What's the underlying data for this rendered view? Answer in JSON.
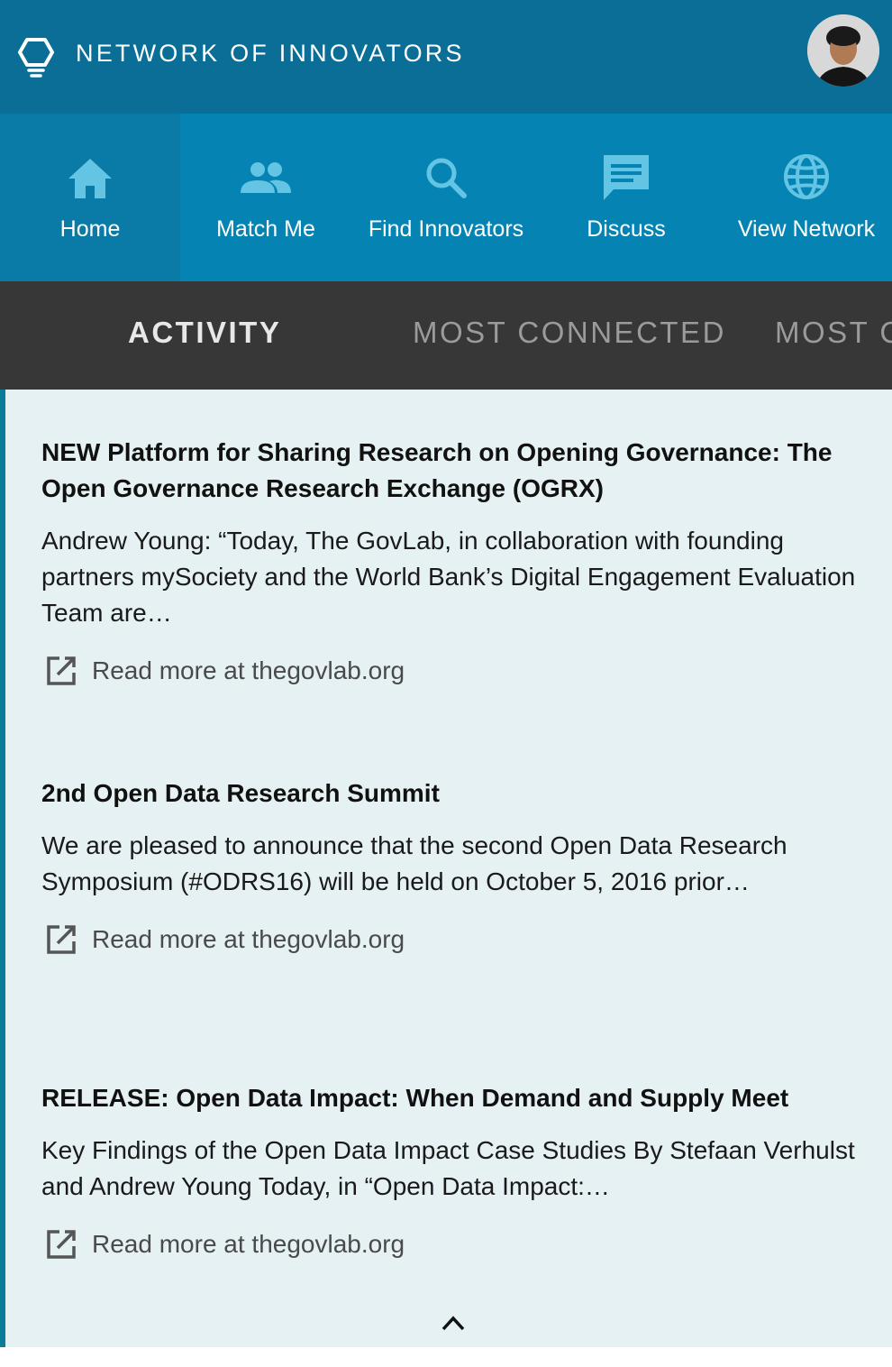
{
  "header": {
    "brand": "NETWORK OF INNOVATORS",
    "logo_icon": "lightbulb-icon",
    "avatar": "user-avatar"
  },
  "nav": {
    "items": [
      {
        "label": "Home",
        "icon": "home-icon",
        "active": true
      },
      {
        "label": "Match Me",
        "icon": "people-icon",
        "active": false
      },
      {
        "label": "Find Innovators",
        "icon": "search-icon",
        "active": false
      },
      {
        "label": "Discuss",
        "icon": "chat-icon",
        "active": false
      },
      {
        "label": "View Network",
        "icon": "globe-icon",
        "active": false
      }
    ]
  },
  "tabs": {
    "items": [
      {
        "label": "ACTIVITY",
        "active": true
      },
      {
        "label": "MOST CONNECTED",
        "active": false
      },
      {
        "label": "MOST C",
        "active": false
      }
    ]
  },
  "articles": [
    {
      "title": "NEW Platform for Sharing Research on Opening Governance: The Open Governance Research Exchange (OGRX)",
      "excerpt": "Andrew Young: “Today,  The GovLab, in collaboration with founding partners mySociety and the World Bank’s Digital Engagement Evaluation Team are…",
      "read_more": "Read more at thegovlab.org"
    },
    {
      "title": "2nd Open Data Research Summit",
      "excerpt": "We are pleased to announce that the second Open Data Research Symposium (#ODRS16) will be held on October 5, 2016 prior…",
      "read_more": "Read more at thegovlab.org"
    },
    {
      "title": "RELEASE: Open Data Impact: When Demand and Supply Meet",
      "excerpt": "Key Findings of the Open Data Impact Case Studies By Stefaan Verhulst and Andrew Young Today, in “Open Data Impact:…",
      "read_more": "Read more at thegovlab.org"
    }
  ],
  "colors": {
    "header_bg": "#0b6e96",
    "nav_bg": "#0584b3",
    "tab_bg": "#373737",
    "content_bg": "#e5f1f3",
    "accent_border": "#0b7b9a"
  }
}
